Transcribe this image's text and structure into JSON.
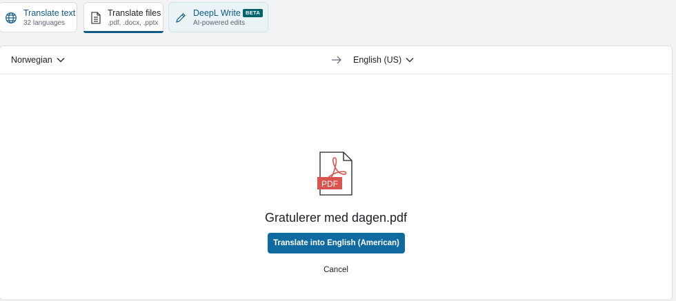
{
  "tabs": {
    "translate_text": {
      "title": "Translate text",
      "subtitle": "32 languages",
      "icon": "globe-icon"
    },
    "translate_files": {
      "title": "Translate files",
      "subtitle": ".pdf, .docx, .pptx",
      "icon": "document-icon"
    },
    "deepl_write": {
      "title": "DeepL Write",
      "badge": "BETA",
      "subtitle": "AI-powered edits",
      "icon": "pen-icon"
    }
  },
  "languages": {
    "source": "Norwegian",
    "target": "English (US)",
    "swap_icon": "arrow-right-icon"
  },
  "file": {
    "icon": "pdf-file-icon",
    "icon_label": "PDF",
    "name": "Gratulerer med dagen.pdf",
    "translate_label": "Translate into English (American)",
    "cancel_label": "Cancel"
  },
  "colors": {
    "accent": "#0f6aa0",
    "tab_active_underline": "#0f5a86",
    "pdf_red": "#d9534f",
    "beta_badge": "#00646d"
  }
}
